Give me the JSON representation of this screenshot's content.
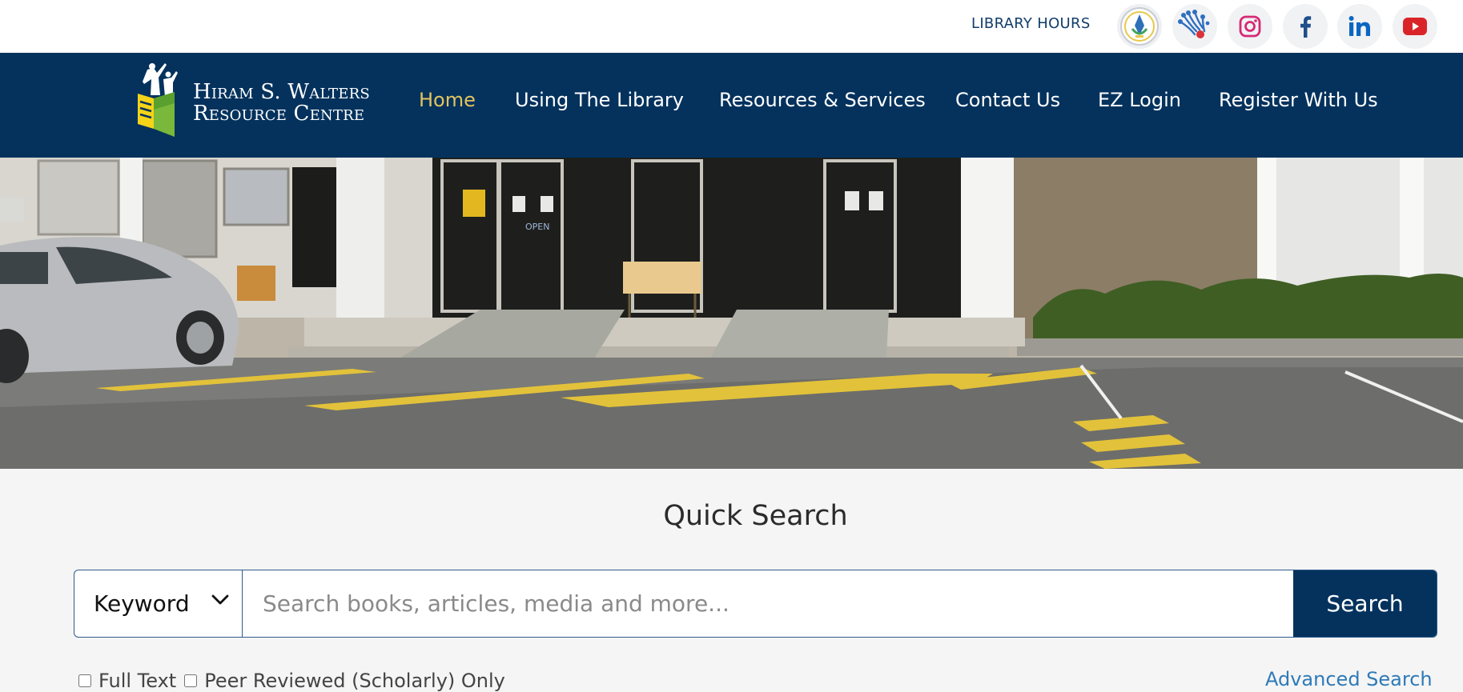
{
  "topbar": {
    "library_hours": "LIBRARY HOURS",
    "icons": [
      "emblem-badge-icon",
      "network-dots-icon",
      "instagram-icon",
      "facebook-icon",
      "linkedin-icon",
      "youtube-icon"
    ]
  },
  "nav": {
    "logo_line1": "Hiram S. Walters",
    "logo_line2": "Resource Centre",
    "items": [
      "Home",
      "Using The Library",
      "Resources & Services",
      "Contact Us",
      "EZ Login",
      "Register With Us"
    ],
    "active_item": "Home"
  },
  "hero": {
    "door_sign": "OPEN"
  },
  "quick_search": {
    "title": "Quick Search",
    "search_type": "Keyword",
    "placeholder": "Search books, articles, media and more...",
    "search_button": "Search",
    "full_text_label": "Full Text",
    "peer_reviewed_label": "Peer Reviewed (Scholarly) Only",
    "advanced_search": "Advanced Search"
  },
  "colors": {
    "nav_bg": "#04325d",
    "active_nav": "#e3c45d",
    "link": "#2e7ab8",
    "instagram": "#d62976",
    "youtube": "#d9252a",
    "linkedin": "#0a66c2",
    "facebook": "#1f4e8a"
  }
}
